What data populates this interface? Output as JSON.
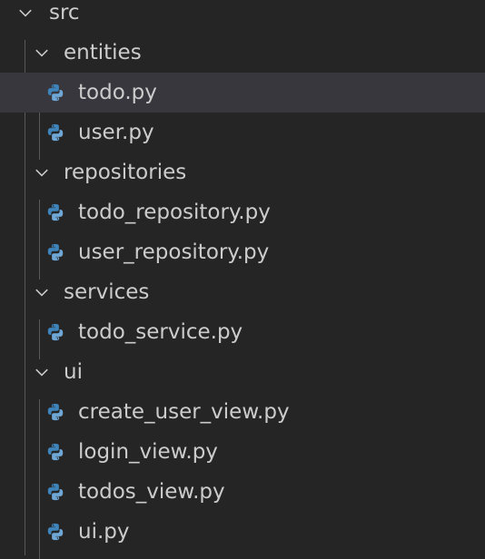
{
  "explorer": {
    "root": {
      "label": "src",
      "expanded": true
    },
    "folders": [
      {
        "label": "entities",
        "expanded": true,
        "files": [
          {
            "label": "todo.py",
            "selected": true
          },
          {
            "label": "user.py",
            "selected": false
          }
        ]
      },
      {
        "label": "repositories",
        "expanded": true,
        "files": [
          {
            "label": "todo_repository.py",
            "selected": false
          },
          {
            "label": "user_repository.py",
            "selected": false
          }
        ]
      },
      {
        "label": "services",
        "expanded": true,
        "files": [
          {
            "label": "todo_service.py",
            "selected": false
          }
        ]
      },
      {
        "label": "ui",
        "expanded": true,
        "files": [
          {
            "label": "create_user_view.py",
            "selected": false
          },
          {
            "label": "login_view.py",
            "selected": false
          },
          {
            "label": "todos_view.py",
            "selected": false
          },
          {
            "label": "ui.py",
            "selected": false
          }
        ]
      }
    ]
  },
  "colors": {
    "background": "#252526",
    "text": "#cccccc",
    "selected_row": "#37373d",
    "indent_guide": "#585858",
    "python_blue": "#3e83ba",
    "python_light": "#6fa8d6"
  }
}
